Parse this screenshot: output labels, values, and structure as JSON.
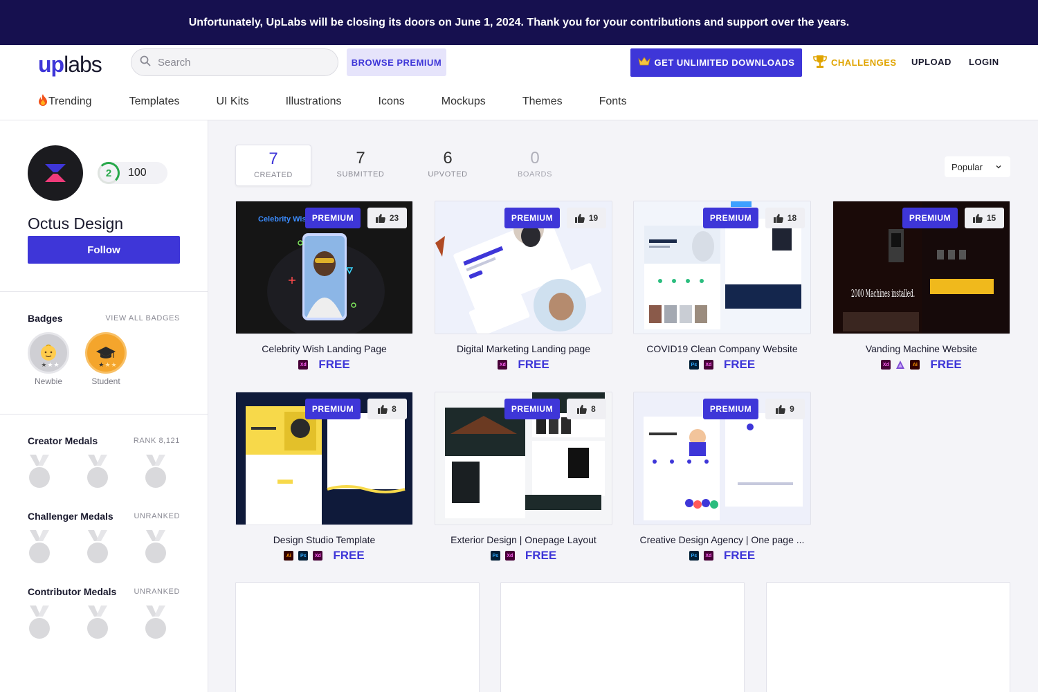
{
  "banner": {
    "text": "Unfortunately, UpLabs will be closing its doors on June 1, 2024. Thank you for your contributions and support over the years."
  },
  "header": {
    "logo_up": "up",
    "logo_labs": "labs",
    "search_placeholder": "Search",
    "browse_premium": "BROWSE PREMIUM",
    "unlimited_downloads": "GET UNLIMITED DOWNLOADS",
    "challenges": "CHALLENGES",
    "upload": "UPLOAD",
    "login": "LOGIN",
    "nav": [
      "Trending",
      "Templates",
      "UI Kits",
      "Illustrations",
      "Icons",
      "Mockups",
      "Themes",
      "Fonts"
    ]
  },
  "profile": {
    "name": "Octus Design",
    "level": "2",
    "points": "100",
    "follow_label": "Follow"
  },
  "badges": {
    "title": "Badges",
    "view_all": "VIEW ALL BADGES",
    "items": [
      {
        "label": "Newbie",
        "color": "#cfcfd4"
      },
      {
        "label": "Student",
        "color": "#f4a52c"
      }
    ]
  },
  "medals": [
    {
      "title": "Creator Medals",
      "right": "RANK 8,121"
    },
    {
      "title": "Challenger Medals",
      "right": "UNRANKED"
    },
    {
      "title": "Contributor Medals",
      "right": "UNRANKED"
    }
  ],
  "tabs": [
    {
      "count": "7",
      "label": "CREATED"
    },
    {
      "count": "7",
      "label": "SUBMITTED"
    },
    {
      "count": "6",
      "label": "UPVOTED"
    },
    {
      "count": "0",
      "label": "BOARDS"
    }
  ],
  "sort": {
    "value": "Popular"
  },
  "cards": [
    {
      "title": "Celebrity Wish Landing Page",
      "premium": "PREMIUM",
      "likes": "23",
      "price": "FREE",
      "tools": [
        "Xd"
      ],
      "thumb_text": "Celebrity Wish"
    },
    {
      "title": "Digital Marketing Landing page",
      "premium": "PREMIUM",
      "likes": "19",
      "price": "FREE",
      "tools": [
        "Xd"
      ]
    },
    {
      "title": "COVID19 Clean Company Website",
      "premium": "PREMIUM",
      "likes": "18",
      "price": "FREE",
      "tools": [
        "Ps",
        "Xd"
      ]
    },
    {
      "title": "Vanding Machine Website",
      "premium": "PREMIUM",
      "likes": "15",
      "price": "FREE",
      "tools": [
        "Xd",
        "Af",
        "Ai"
      ],
      "thumb_text": "2000 Machines installed."
    },
    {
      "title": "Design Studio Template",
      "premium": "PREMIUM",
      "likes": "8",
      "price": "FREE",
      "tools": [
        "Ai",
        "Ps",
        "Xd"
      ]
    },
    {
      "title": "Exterior Design | Onepage Layout",
      "premium": "PREMIUM",
      "likes": "8",
      "price": "FREE",
      "tools": [
        "Ps",
        "Xd"
      ]
    },
    {
      "title": "Creative Design Agency | One page ...",
      "premium": "PREMIUM",
      "likes": "9",
      "price": "FREE",
      "tools": [
        "Ps",
        "Xd"
      ]
    }
  ],
  "colors": {
    "accent": "#3e36d8",
    "banner_bg": "#16104f",
    "challenges": "#e0a400"
  }
}
